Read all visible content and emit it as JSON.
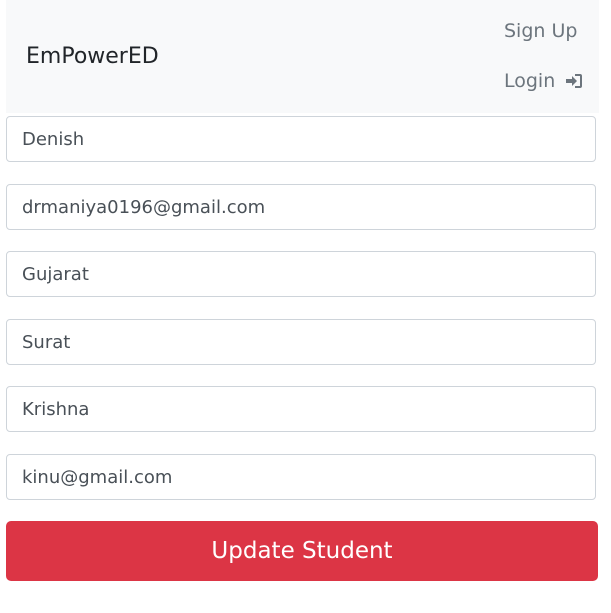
{
  "navbar": {
    "brand": "EmPowerED",
    "links": {
      "signup": "Sign Up",
      "login": "Login",
      "login_icon": "sign-in-icon"
    }
  },
  "form": {
    "fields": [
      {
        "name": "name",
        "value": "Denish"
      },
      {
        "name": "email",
        "value": "drmaniya0196@gmail.com"
      },
      {
        "name": "state",
        "value": "Gujarat"
      },
      {
        "name": "city",
        "value": "Surat"
      },
      {
        "name": "parent_name",
        "value": "Krishna"
      },
      {
        "name": "parent_email",
        "value": "kinu@gmail.com"
      }
    ],
    "submit_label": "Update Student"
  },
  "colors": {
    "navbar_bg": "#f8f9fa",
    "link": "#6c757d",
    "danger": "#dc3545",
    "input_border": "#ced4da"
  }
}
